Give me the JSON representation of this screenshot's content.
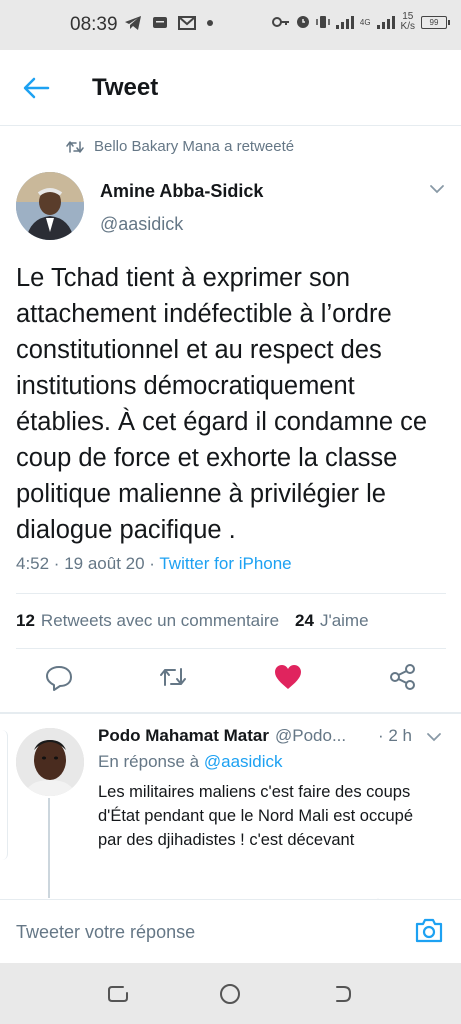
{
  "status_bar": {
    "time": "08:39",
    "net_speed_value": "15",
    "net_speed_unit": "K/s",
    "battery": "99",
    "network_type": "4G"
  },
  "header": {
    "title": "Tweet"
  },
  "retweet_context": "Bello Bakary Mana a retweeté",
  "tweet": {
    "author_name": "Amine Abba-Sidick",
    "author_handle": "@aasidick",
    "text": "Le Tchad tient à exprimer son attachement indéfectible à l’ordre constitutionnel et au respect des institutions démocratiquement établies. À cet égard il condamne ce coup de force et exhorte la classe politique malienne à privilégier le dialogue pacifique .",
    "time": "4:52 · 19 août 20 · ",
    "source": "Twitter for iPhone",
    "retweets_count": "12",
    "retweets_label": "Retweets avec un commentaire",
    "likes_count": "24",
    "likes_label": "J'aime"
  },
  "reply": {
    "author_name": "Podo Mahamat Matar",
    "author_handle": "@Podo...",
    "time": "· 2 h",
    "reply_to_prefix": "En réponse à ",
    "reply_to_handle": "@aasidick",
    "text": "Les militaires maliens c'est faire des coups d'État pendant que le Nord Mali est occupé par des djihadistes ! c'est décevant"
  },
  "compose": {
    "placeholder": "Tweeter votre réponse"
  },
  "colors": {
    "accent": "#1da1f2",
    "like": "#e0245e",
    "secondary_text": "#657786"
  }
}
